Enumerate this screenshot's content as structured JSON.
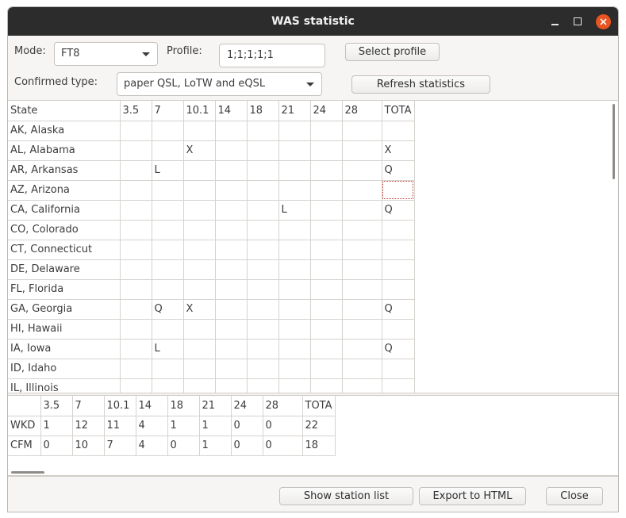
{
  "window": {
    "title": "WAS statistic"
  },
  "controls": {
    "mode_label": "Mode:",
    "mode_value": "FT8",
    "profile_label": "Profile:",
    "profile_value": "1;1;1;1;1",
    "select_profile": "Select profile",
    "confirmed_type_label": "Confirmed type:",
    "confirmed_type_value": "paper QSL, LoTW and eQSL",
    "refresh": "Refresh statistics"
  },
  "states_table": {
    "headers": [
      "State",
      "3.5",
      "7",
      "10.1",
      "14",
      "18",
      "21",
      "24",
      "28",
      "TOTA"
    ],
    "rows": [
      [
        "AK, Alaska",
        "",
        "",
        "",
        "",
        "",
        "",
        "",
        "",
        ""
      ],
      [
        "AL, Alabama",
        "",
        "",
        "X",
        "",
        "",
        "",
        "",
        "",
        "X"
      ],
      [
        "AR, Arkansas",
        "",
        "L",
        "",
        "",
        "",
        "",
        "",
        "",
        "Q"
      ],
      [
        "AZ, Arizona",
        "",
        "",
        "",
        "",
        "",
        "",
        "",
        "",
        ""
      ],
      [
        "CA, California",
        "",
        "",
        "",
        "",
        "",
        "L",
        "",
        "",
        "Q"
      ],
      [
        "CO, Colorado",
        "",
        "",
        "",
        "",
        "",
        "",
        "",
        "",
        ""
      ],
      [
        "CT, Connecticut",
        "",
        "",
        "",
        "",
        "",
        "",
        "",
        "",
        ""
      ],
      [
        "DE, Delaware",
        "",
        "",
        "",
        "",
        "",
        "",
        "",
        "",
        ""
      ],
      [
        "FL, Florida",
        "",
        "",
        "",
        "",
        "",
        "",
        "",
        "",
        ""
      ],
      [
        "GA, Georgia",
        "",
        "Q",
        "X",
        "",
        "",
        "",
        "",
        "",
        "Q"
      ],
      [
        "HI, Hawaii",
        "",
        "",
        "",
        "",
        "",
        "",
        "",
        "",
        ""
      ],
      [
        "IA, Iowa",
        "",
        "L",
        "",
        "",
        "",
        "",
        "",
        "",
        "Q"
      ],
      [
        "ID, Idaho",
        "",
        "",
        "",
        "",
        "",
        "",
        "",
        "",
        ""
      ],
      [
        "IL, Illinois",
        "",
        "",
        "",
        "",
        "",
        "",
        "",
        "",
        ""
      ]
    ]
  },
  "summary_table": {
    "headers": [
      "",
      "3.5",
      "7",
      "10.1",
      "14",
      "18",
      "21",
      "24",
      "28",
      "TOTA"
    ],
    "rows": [
      [
        "WKD",
        "1",
        "12",
        "11",
        "4",
        "1",
        "1",
        "0",
        "0",
        "22"
      ],
      [
        "CFM",
        "0",
        "10",
        "7",
        "4",
        "0",
        "1",
        "0",
        "0",
        "18"
      ]
    ]
  },
  "footer": {
    "show_station_list": "Show station list",
    "export_html": "Export to HTML",
    "close": "Close"
  }
}
